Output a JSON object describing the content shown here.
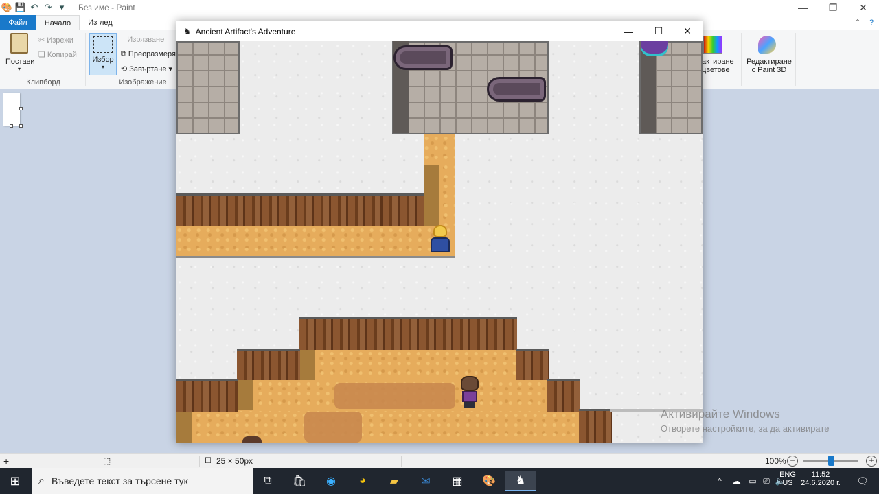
{
  "paint": {
    "title": "Без име - Paint",
    "tabs": {
      "file": "Файл",
      "home": "Начало",
      "view": "Изглед"
    },
    "clipboard": {
      "paste": "Постави",
      "cut": "Изрежи",
      "copy": "Копирай",
      "group": "Клипборд"
    },
    "image": {
      "select": "Избор",
      "crop": "Изрязване",
      "resize": "Преоразмеря",
      "rotate": "Завъртане",
      "group": "Изображение"
    },
    "right": {
      "edit_colors": "актиране\nцветове",
      "paint3d": "Редактиране\nс Paint 3D"
    },
    "status": {
      "size": "25 × 50px",
      "zoom": "100%"
    }
  },
  "game": {
    "title": "Ancient Artifact's Adventure"
  },
  "watermark": {
    "line1": "Активирайте Windows",
    "line2": "Отворете настройките, за да активирате"
  },
  "taskbar": {
    "search_placeholder": "Въведете текст за търсене тук",
    "lang1": "ENG",
    "lang2": "US",
    "time": "11:52",
    "date": "24.6.2020 г."
  }
}
